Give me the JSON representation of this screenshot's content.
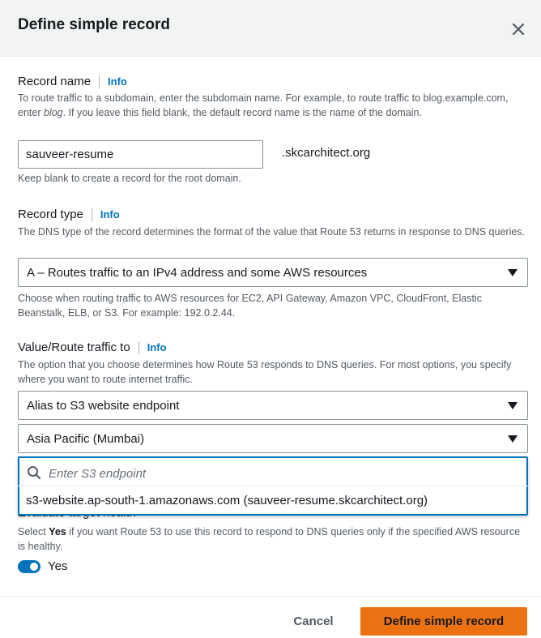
{
  "dialog": {
    "title": "Define simple record"
  },
  "record_name": {
    "label": "Record name",
    "info": "Info",
    "desc_part1": "To route traffic to a subdomain, enter the subdomain name. For example, to route traffic to blog.example.com, enter ",
    "desc_em": "blog",
    "desc_part2": ". If you leave this field blank, the default record name is the name of the domain.",
    "value": "sauveer-resume",
    "suffix": ".skcarchitect.org",
    "hint": "Keep blank to create a record for the root domain."
  },
  "record_type": {
    "label": "Record type",
    "info": "Info",
    "desc": "The DNS type of the record determines the format of the value that Route 53 returns in response to DNS queries.",
    "selected": "A – Routes traffic to an IPv4 address and some AWS resources",
    "hint": "Choose when routing traffic to AWS resources for EC2, API Gateway, Amazon VPC, CloudFront, Elastic Beanstalk, ELB, or S3. For example: 192.0.2.44."
  },
  "route_traffic": {
    "label": "Value/Route traffic to",
    "info": "Info",
    "desc": "The option that you choose determines how Route 53 responds to DNS queries. For most options, you specify where you want to route internet traffic.",
    "endpoint_type": "Alias to S3 website endpoint",
    "region": "Asia Pacific (Mumbai)",
    "search_placeholder": "Enter S3 endpoint",
    "option": "s3-website.ap-south-1.amazonaws.com (sauveer-resume.skcarchitect.org)"
  },
  "evaluate_health": {
    "label": "Evaluate target health",
    "desc_pre": "Select ",
    "desc_bold": "Yes",
    "desc_post": " if you want Route 53 to use this record to respond to DNS queries only if the specified AWS resource is healthy.",
    "toggle_label": "Yes",
    "enabled": true
  },
  "footer": {
    "cancel": "Cancel",
    "submit": "Define simple record"
  },
  "colors": {
    "accent": "#0073bb",
    "primary_button": "#ec7211"
  }
}
